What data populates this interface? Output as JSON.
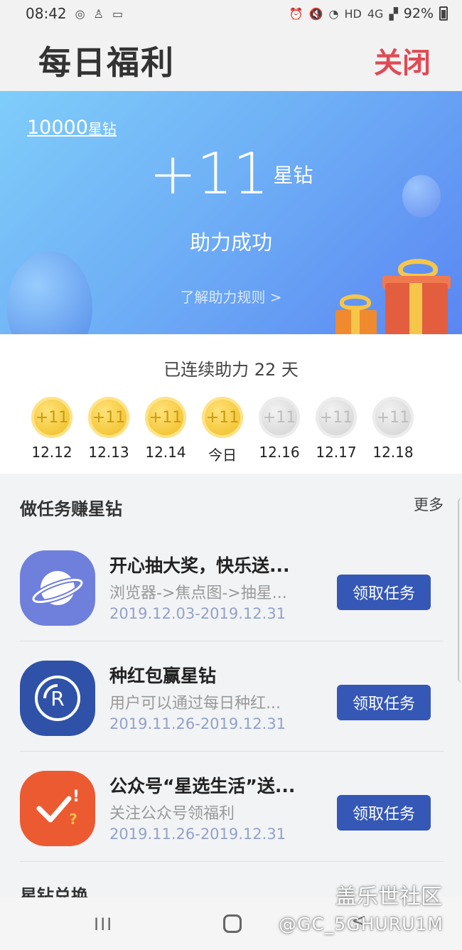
{
  "status_bar": {
    "time": "08:42",
    "battery": "92%",
    "network": "HD",
    "network_type": "4G"
  },
  "header": {
    "title": "每日福利",
    "close_label": "关闭"
  },
  "banner": {
    "balance_value": "10000",
    "balance_unit": "星钻",
    "reward_amount": "+11",
    "reward_unit": "星钻",
    "success_text": "助力成功",
    "rules_link": "了解助力规则 >"
  },
  "checkin": {
    "streak_text": "已连续助力 22 天",
    "days": [
      {
        "coin": "+11",
        "label": "12.12",
        "claimed": true
      },
      {
        "coin": "+11",
        "label": "12.13",
        "claimed": true
      },
      {
        "coin": "+11",
        "label": "12.14",
        "claimed": true
      },
      {
        "coin": "+11",
        "label": "今日",
        "claimed": true
      },
      {
        "coin": "+11",
        "label": "12.16",
        "claimed": false
      },
      {
        "coin": "+11",
        "label": "12.17",
        "claimed": false
      },
      {
        "coin": "+11",
        "label": "12.18",
        "claimed": false
      }
    ]
  },
  "tasks": {
    "section_title": "做任务赚星钻",
    "more_label": "更多",
    "items": [
      {
        "title": "开心抽大奖，快乐送...",
        "desc": "浏览器->焦点图->抽星...",
        "date": "2019.12.03-2019.12.31",
        "button": "领取任务",
        "icon": "planet-icon",
        "icon_color": "#6f7fdc"
      },
      {
        "title": "种红包赢星钻",
        "desc": "用户可以通过每日种红...",
        "date": "2019.11.26-2019.12.31",
        "button": "领取任务",
        "icon": "r-coin-icon",
        "icon_color": "#2f52a8"
      },
      {
        "title": "公众号“星选生活”送...",
        "desc": "关注公众号领福利",
        "date": "2019.11.26-2019.12.31",
        "button": "领取任务",
        "icon": "check-question-icon",
        "icon_color": "#ec5a32"
      }
    ]
  },
  "exchange": {
    "section_title": "星钻兑换"
  },
  "nav": {
    "recent_label": "III",
    "back_label": "<"
  },
  "watermark": {
    "line1": "盖乐世社区",
    "line2": "@GC_5GHURU1M"
  },
  "colors": {
    "accent_red": "#e04a55",
    "button_blue": "#3558b6",
    "date_blue": "#92a2c8"
  }
}
